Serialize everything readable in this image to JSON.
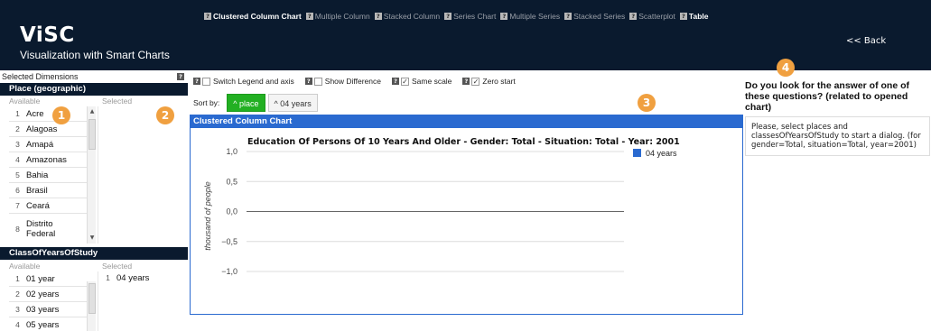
{
  "header": {
    "logo": "ViSC",
    "subtitle": "Visualization with Smart Charts",
    "back": "<< Back",
    "tabs": [
      {
        "label": "Clustered Column Chart",
        "active": true
      },
      {
        "label": "Multiple Column",
        "active": false
      },
      {
        "label": "Stacked Column",
        "active": false
      },
      {
        "label": "Series Chart",
        "active": false
      },
      {
        "label": "Multiple Series",
        "active": false
      },
      {
        "label": "Stacked Series",
        "active": false
      },
      {
        "label": "Scatterplot",
        "active": false
      },
      {
        "label": "Table",
        "active": true
      }
    ],
    "help_glyph": "?"
  },
  "left": {
    "heading": "Selected Dimensions",
    "place": {
      "title": "Place (geographic)",
      "available_label": "Available",
      "selected_label": "Selected",
      "items": [
        {
          "n": "1",
          "label": "Acre"
        },
        {
          "n": "2",
          "label": "Alagoas"
        },
        {
          "n": "3",
          "label": "Amapá"
        },
        {
          "n": "4",
          "label": "Amazonas"
        },
        {
          "n": "5",
          "label": "Bahia"
        },
        {
          "n": "6",
          "label": "Brasil"
        },
        {
          "n": "7",
          "label": "Ceará"
        },
        {
          "n": "8",
          "label": "Distrito Federal"
        }
      ]
    },
    "years": {
      "title": "ClassOfYearsOfStudy",
      "available_label": "Available",
      "selected_label": "Selected",
      "items": [
        {
          "n": "1",
          "label": "01 year"
        },
        {
          "n": "2",
          "label": "02 years"
        },
        {
          "n": "3",
          "label": "03 years"
        },
        {
          "n": "4",
          "label": "05 years"
        }
      ],
      "selected": [
        {
          "n": "1",
          "label": "04 years"
        }
      ]
    }
  },
  "badges": [
    "1",
    "2",
    "3",
    "4"
  ],
  "options": {
    "switch_legend": {
      "label": "Switch Legend and axis",
      "checked": false
    },
    "show_difference": {
      "label": "Show Difference",
      "checked": false
    },
    "same_scale": {
      "label": "Same scale",
      "checked": true
    },
    "zero_start": {
      "label": "Zero start",
      "checked": true
    },
    "check_glyph": "✓"
  },
  "sort": {
    "label": "Sort by:",
    "buttons": [
      {
        "label": "^ place",
        "active": true
      },
      {
        "label": "^ 04 years",
        "active": false
      }
    ]
  },
  "chart_panel": {
    "title": "Clustered Column Chart"
  },
  "chart_data": {
    "type": "bar",
    "title": "Education Of Persons Of 10 Years And Older - Gender: Total - Situation: Total - Year: 2001",
    "ylabel": "thousand of people",
    "xlabel": "",
    "categories": [],
    "series": [
      {
        "name": "04 years",
        "values": [],
        "color": "#2a6ad0"
      }
    ],
    "yticks": [
      "1,0",
      "0,5",
      "0,0",
      "−0,5",
      "−1,0"
    ],
    "ylim": [
      -1,
      1
    ],
    "grid": true,
    "legend": "top-right"
  },
  "right": {
    "question": "Do you look for the answer of one of these questions? (related to opened chart)",
    "answer": "Please, select places and classesOfYearsOfStudy to start a dialog. (for gender=Total, situation=Total, year=2001)"
  },
  "colors": {
    "header_bg": "#0a1a2e",
    "accent_blue": "#2a6ad0",
    "sort_active": "#22b022",
    "badge": "#f0a040"
  }
}
